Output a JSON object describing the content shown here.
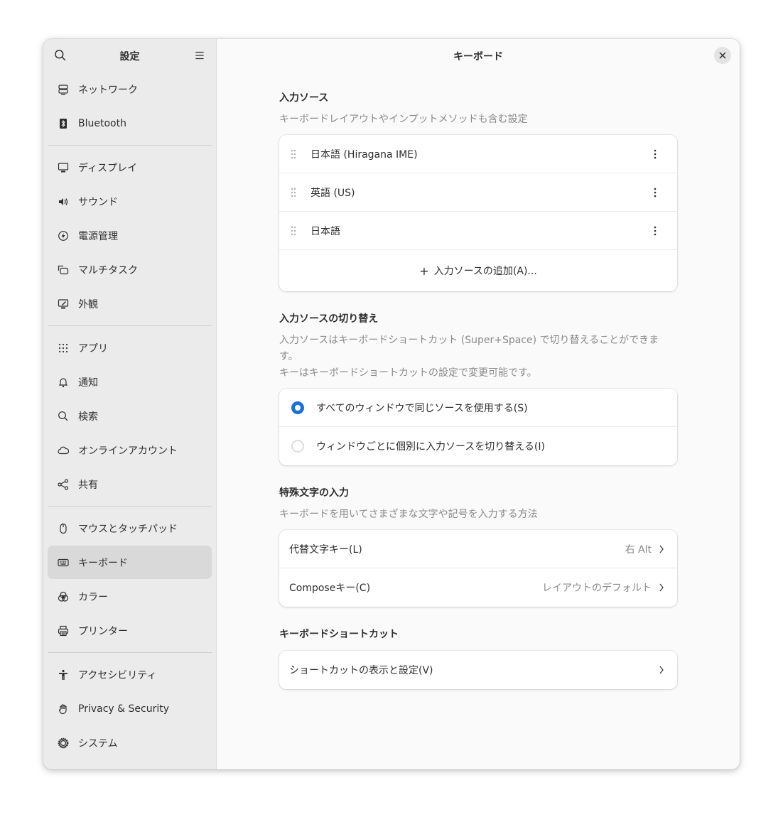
{
  "sidebar": {
    "title": "設定",
    "groups": [
      [
        {
          "label": "ネットワーク",
          "icon": "network-icon"
        },
        {
          "label": "Bluetooth",
          "icon": "bluetooth-icon"
        }
      ],
      [
        {
          "label": "ディスプレイ",
          "icon": "display-icon"
        },
        {
          "label": "サウンド",
          "icon": "sound-icon"
        },
        {
          "label": "電源管理",
          "icon": "power-icon"
        },
        {
          "label": "マルチタスク",
          "icon": "multitasking-icon"
        },
        {
          "label": "外観",
          "icon": "appearance-icon"
        }
      ],
      [
        {
          "label": "アプリ",
          "icon": "apps-icon"
        },
        {
          "label": "通知",
          "icon": "bell-icon"
        },
        {
          "label": "検索",
          "icon": "search-icon"
        },
        {
          "label": "オンラインアカウント",
          "icon": "cloud-icon"
        },
        {
          "label": "共有",
          "icon": "share-icon"
        }
      ],
      [
        {
          "label": "マウスとタッチパッド",
          "icon": "mouse-icon"
        },
        {
          "label": "キーボード",
          "icon": "keyboard-icon",
          "active": true
        },
        {
          "label": "カラー",
          "icon": "color-icon"
        },
        {
          "label": "プリンター",
          "icon": "printer-icon"
        }
      ],
      [
        {
          "label": "アクセシビリティ",
          "icon": "accessibility-icon"
        },
        {
          "label": "Privacy & Security",
          "icon": "hand-icon"
        },
        {
          "label": "システム",
          "icon": "gear-icon"
        }
      ]
    ]
  },
  "main": {
    "title": "キーボード",
    "input_sources": {
      "title": "入力ソース",
      "description": "キーボードレイアウトやインプットメソッドも含む設定",
      "items": [
        "日本語 (Hiragana IME)",
        "英語 (US)",
        "日本語"
      ],
      "add_label": "入力ソースの追加(A)..."
    },
    "switching": {
      "title": "入力ソースの切り替え",
      "description_1": "入力ソースはキーボードショートカット (Super+Space) で切り替えることができます。",
      "description_2": "キーはキーボードショートカットの設定で変更可能です。",
      "options": [
        {
          "label": "すべてのウィンドウで同じソースを使用する(S)",
          "checked": true
        },
        {
          "label": "ウィンドウごとに個別に入力ソースを切り替える(I)",
          "checked": false
        }
      ]
    },
    "special_chars": {
      "title": "特殊文字の入力",
      "description": "キーボードを用いてさまざまな文字や記号を入力する方法",
      "rows": [
        {
          "label": "代替文字キー(L)",
          "value": "右 Alt"
        },
        {
          "label": "Composeキー(C)",
          "value": "レイアウトのデフォルト"
        }
      ]
    },
    "shortcuts": {
      "title": "キーボードショートカット",
      "row_label": "ショートカットの表示と設定(V)"
    }
  },
  "colors": {
    "accent": "#1c71d8",
    "sidebar_bg": "#ebebeb",
    "active_item_bg": "#d9d9d9"
  }
}
